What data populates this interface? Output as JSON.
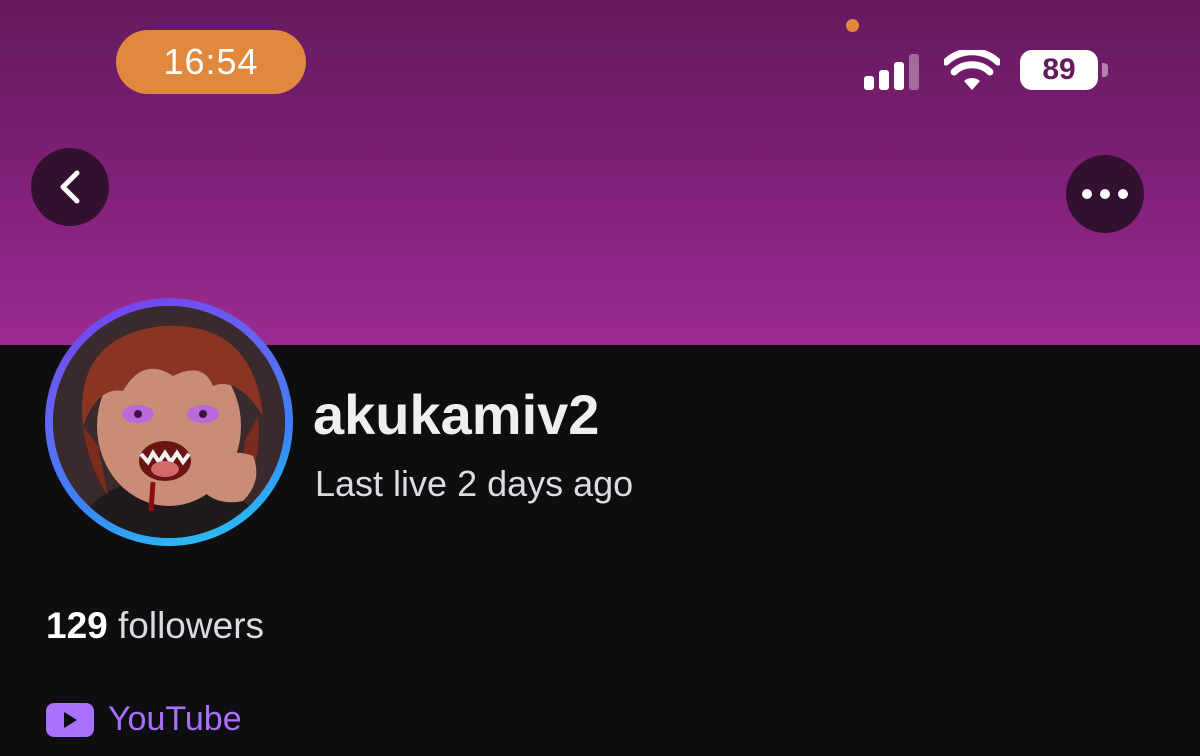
{
  "status_bar": {
    "time": "16:54",
    "battery": "89",
    "icons": [
      "signal-icon",
      "wifi-icon",
      "battery-icon"
    ]
  },
  "nav": {
    "back_icon": "chevron-left-icon",
    "more_icon": "ellipsis-icon"
  },
  "profile": {
    "username": "akukamiv2",
    "last_live": "Last live 2 days ago",
    "followers_count": "129",
    "followers_label": " followers",
    "links": [
      {
        "label": "YouTube",
        "icon": "youtube-icon"
      }
    ]
  },
  "colors": {
    "banner_top": "#651a5e",
    "banner_bottom": "#9b2b92",
    "background": "#0e0e10",
    "accent": "#a970ff",
    "time_pill": "#e0883e"
  }
}
